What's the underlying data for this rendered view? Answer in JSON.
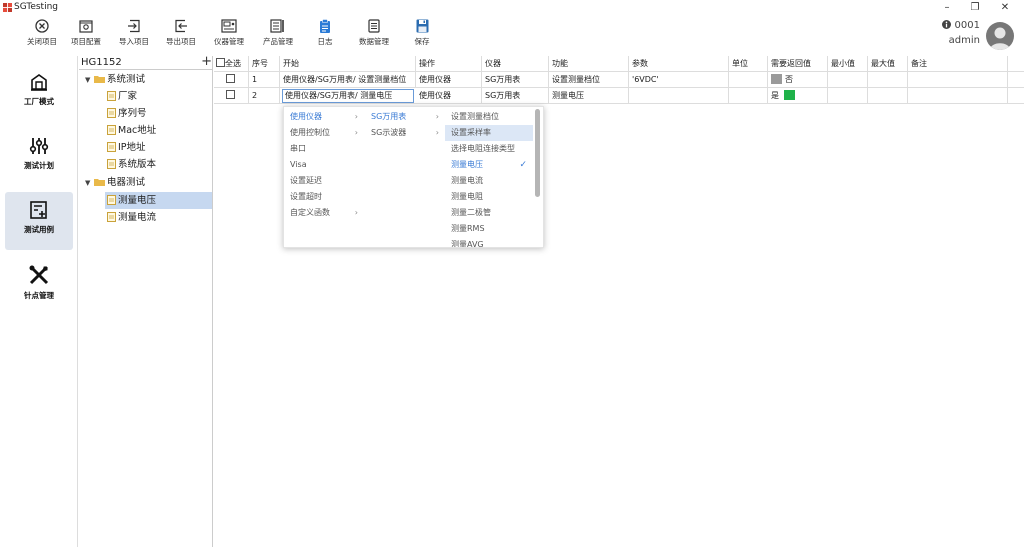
{
  "app": {
    "title": "SGTesting"
  },
  "window_controls": {
    "minimize": "–",
    "restore": "❐",
    "close": "✕"
  },
  "toolbar": {
    "close_project": "关闭项目",
    "project_config": "项目配置",
    "import_project": "导入项目",
    "export_project": "导出项目",
    "instrument_mgmt": "仪器管理",
    "product_mgmt": "产品管理",
    "log": "日志",
    "data_mgmt": "数据管理",
    "save": "保存"
  },
  "user": {
    "id": "0001",
    "name": "admin"
  },
  "nav": {
    "factory_mode": "工厂模式",
    "test_plan": "测试计划",
    "test_case": "测试用例",
    "pin_mgmt": "针点管理"
  },
  "tree": {
    "title": "HG1152",
    "add": "+",
    "groups": [
      {
        "label": "系统测试",
        "children": [
          "厂家",
          "序列号",
          "Mac地址",
          "IP地址",
          "系统版本"
        ]
      },
      {
        "label": "电器测试",
        "children": [
          "测量电压",
          "测量电流"
        ]
      }
    ]
  },
  "grid": {
    "headers": {
      "select_all": "全选",
      "seq": "序号",
      "start": "开始",
      "operation": "操作",
      "instrument": "仪器",
      "function": "功能",
      "params": "参数",
      "unit": "单位",
      "need_return": "需要返回值",
      "min": "最小值",
      "max": "最大值",
      "remark": "备注"
    },
    "rows": [
      {
        "seq": "1",
        "start": "使用仪器/SG万用表/ 设置测量档位",
        "operation": "使用仪器",
        "instrument": "SG万用表",
        "function": "设置测量档位",
        "params": "'6VDC'",
        "need_return": "否",
        "return_color": "#9a9a9a"
      },
      {
        "seq": "2",
        "start": "使用仪器/SG万用表/ 测量电压",
        "operation": "使用仪器",
        "instrument": "SG万用表",
        "function": "测量电压",
        "params": "",
        "need_return": "是",
        "return_color": "#1fb24a"
      }
    ]
  },
  "menu": {
    "col1": [
      "使用仪器",
      "使用控制位",
      "串口",
      "Visa",
      "设置延迟",
      "设置超时",
      "自定义函数"
    ],
    "col2": [
      "SG万用表",
      "SG示波器"
    ],
    "col3": [
      "设置测量档位",
      "设置采样率",
      "选择电阻连接类型",
      "测量电压",
      "测量电流",
      "测量电阻",
      "测量二极管",
      "测量RMS",
      "测量AVG"
    ],
    "arrow": "›",
    "check": "✓"
  },
  "colors": {
    "accent": "#3a7bd5",
    "selected_tree": "#c6d8f0",
    "nav_active": "#dfe5ee",
    "folder": "#e9b949",
    "return_yes": "#1fb24a",
    "return_no": "#9a9a9a"
  }
}
